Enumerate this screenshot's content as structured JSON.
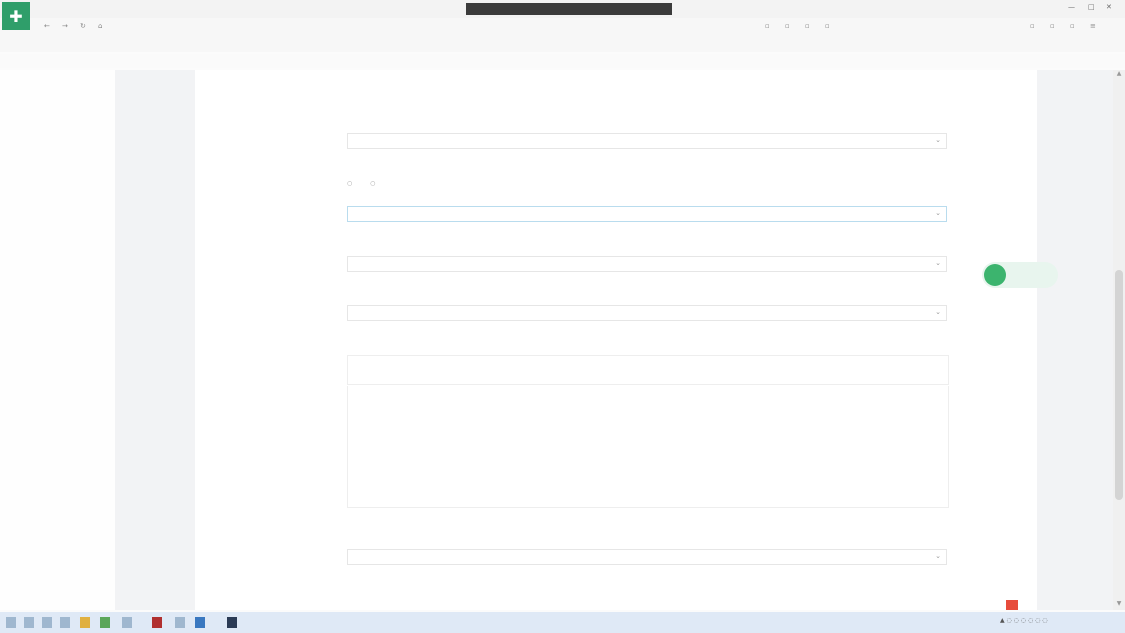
{
  "browser": {
    "tabs": [
      "",
      "",
      "",
      "",
      "",
      "",
      "",
      ""
    ],
    "window_controls": [
      "—",
      "□",
      "✕"
    ],
    "address": "",
    "nav_buttons": [
      "←",
      "→",
      "↻",
      "⌂"
    ],
    "bookmarks": [
      "",
      "",
      "",
      "",
      "",
      "",
      "",
      "",
      "",
      "",
      "",
      "",
      "",
      "",
      "",
      ""
    ],
    "bookmarks2": [
      "",
      "",
      "",
      ""
    ]
  },
  "form": {
    "rows": [
      {
        "label": "",
        "value": "",
        "help": ""
      },
      {
        "label": "",
        "value": "",
        "help": "",
        "radio_options": [
          "",
          ""
        ]
      },
      {
        "label": "",
        "value": "",
        "help": ""
      },
      {
        "label": "",
        "value": "",
        "help": ""
      },
      {
        "label": "",
        "value": "",
        "help": ""
      }
    ],
    "editor": {
      "label": "",
      "toolbar_row1": "",
      "toolbar_row2": "",
      "help": "",
      "counter": ""
    },
    "last_row": {
      "label": "",
      "value": "",
      "help": ""
    }
  },
  "float_widget": {
    "text": ""
  },
  "taskbar": {
    "clock": ""
  },
  "colors": {
    "brand": "#2f9e6a",
    "accent_green": "#3cb46e",
    "link_blue": "#4a7bbf",
    "taskbar": "#dfe9f6"
  }
}
